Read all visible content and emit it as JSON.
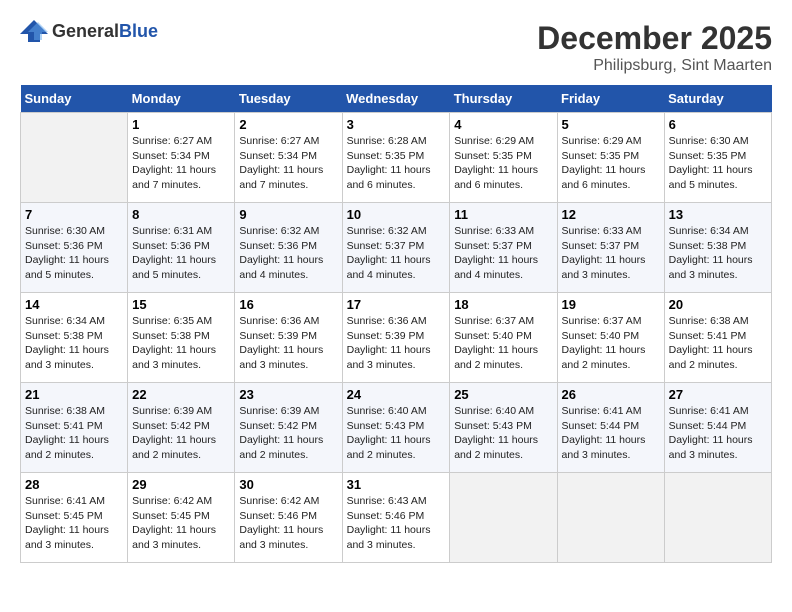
{
  "header": {
    "logo_general": "General",
    "logo_blue": "Blue",
    "month_title": "December 2025",
    "location": "Philipsburg, Sint Maarten"
  },
  "days_of_week": [
    "Sunday",
    "Monday",
    "Tuesday",
    "Wednesday",
    "Thursday",
    "Friday",
    "Saturday"
  ],
  "weeks": [
    [
      {
        "day": "",
        "sunrise": "",
        "sunset": "",
        "daylight": ""
      },
      {
        "day": "1",
        "sunrise": "Sunrise: 6:27 AM",
        "sunset": "Sunset: 5:34 PM",
        "daylight": "Daylight: 11 hours and 7 minutes."
      },
      {
        "day": "2",
        "sunrise": "Sunrise: 6:27 AM",
        "sunset": "Sunset: 5:34 PM",
        "daylight": "Daylight: 11 hours and 7 minutes."
      },
      {
        "day": "3",
        "sunrise": "Sunrise: 6:28 AM",
        "sunset": "Sunset: 5:35 PM",
        "daylight": "Daylight: 11 hours and 6 minutes."
      },
      {
        "day": "4",
        "sunrise": "Sunrise: 6:29 AM",
        "sunset": "Sunset: 5:35 PM",
        "daylight": "Daylight: 11 hours and 6 minutes."
      },
      {
        "day": "5",
        "sunrise": "Sunrise: 6:29 AM",
        "sunset": "Sunset: 5:35 PM",
        "daylight": "Daylight: 11 hours and 6 minutes."
      },
      {
        "day": "6",
        "sunrise": "Sunrise: 6:30 AM",
        "sunset": "Sunset: 5:35 PM",
        "daylight": "Daylight: 11 hours and 5 minutes."
      }
    ],
    [
      {
        "day": "7",
        "sunrise": "Sunrise: 6:30 AM",
        "sunset": "Sunset: 5:36 PM",
        "daylight": "Daylight: 11 hours and 5 minutes."
      },
      {
        "day": "8",
        "sunrise": "Sunrise: 6:31 AM",
        "sunset": "Sunset: 5:36 PM",
        "daylight": "Daylight: 11 hours and 5 minutes."
      },
      {
        "day": "9",
        "sunrise": "Sunrise: 6:32 AM",
        "sunset": "Sunset: 5:36 PM",
        "daylight": "Daylight: 11 hours and 4 minutes."
      },
      {
        "day": "10",
        "sunrise": "Sunrise: 6:32 AM",
        "sunset": "Sunset: 5:37 PM",
        "daylight": "Daylight: 11 hours and 4 minutes."
      },
      {
        "day": "11",
        "sunrise": "Sunrise: 6:33 AM",
        "sunset": "Sunset: 5:37 PM",
        "daylight": "Daylight: 11 hours and 4 minutes."
      },
      {
        "day": "12",
        "sunrise": "Sunrise: 6:33 AM",
        "sunset": "Sunset: 5:37 PM",
        "daylight": "Daylight: 11 hours and 3 minutes."
      },
      {
        "day": "13",
        "sunrise": "Sunrise: 6:34 AM",
        "sunset": "Sunset: 5:38 PM",
        "daylight": "Daylight: 11 hours and 3 minutes."
      }
    ],
    [
      {
        "day": "14",
        "sunrise": "Sunrise: 6:34 AM",
        "sunset": "Sunset: 5:38 PM",
        "daylight": "Daylight: 11 hours and 3 minutes."
      },
      {
        "day": "15",
        "sunrise": "Sunrise: 6:35 AM",
        "sunset": "Sunset: 5:38 PM",
        "daylight": "Daylight: 11 hours and 3 minutes."
      },
      {
        "day": "16",
        "sunrise": "Sunrise: 6:36 AM",
        "sunset": "Sunset: 5:39 PM",
        "daylight": "Daylight: 11 hours and 3 minutes."
      },
      {
        "day": "17",
        "sunrise": "Sunrise: 6:36 AM",
        "sunset": "Sunset: 5:39 PM",
        "daylight": "Daylight: 11 hours and 3 minutes."
      },
      {
        "day": "18",
        "sunrise": "Sunrise: 6:37 AM",
        "sunset": "Sunset: 5:40 PM",
        "daylight": "Daylight: 11 hours and 2 minutes."
      },
      {
        "day": "19",
        "sunrise": "Sunrise: 6:37 AM",
        "sunset": "Sunset: 5:40 PM",
        "daylight": "Daylight: 11 hours and 2 minutes."
      },
      {
        "day": "20",
        "sunrise": "Sunrise: 6:38 AM",
        "sunset": "Sunset: 5:41 PM",
        "daylight": "Daylight: 11 hours and 2 minutes."
      }
    ],
    [
      {
        "day": "21",
        "sunrise": "Sunrise: 6:38 AM",
        "sunset": "Sunset: 5:41 PM",
        "daylight": "Daylight: 11 hours and 2 minutes."
      },
      {
        "day": "22",
        "sunrise": "Sunrise: 6:39 AM",
        "sunset": "Sunset: 5:42 PM",
        "daylight": "Daylight: 11 hours and 2 minutes."
      },
      {
        "day": "23",
        "sunrise": "Sunrise: 6:39 AM",
        "sunset": "Sunset: 5:42 PM",
        "daylight": "Daylight: 11 hours and 2 minutes."
      },
      {
        "day": "24",
        "sunrise": "Sunrise: 6:40 AM",
        "sunset": "Sunset: 5:43 PM",
        "daylight": "Daylight: 11 hours and 2 minutes."
      },
      {
        "day": "25",
        "sunrise": "Sunrise: 6:40 AM",
        "sunset": "Sunset: 5:43 PM",
        "daylight": "Daylight: 11 hours and 2 minutes."
      },
      {
        "day": "26",
        "sunrise": "Sunrise: 6:41 AM",
        "sunset": "Sunset: 5:44 PM",
        "daylight": "Daylight: 11 hours and 3 minutes."
      },
      {
        "day": "27",
        "sunrise": "Sunrise: 6:41 AM",
        "sunset": "Sunset: 5:44 PM",
        "daylight": "Daylight: 11 hours and 3 minutes."
      }
    ],
    [
      {
        "day": "28",
        "sunrise": "Sunrise: 6:41 AM",
        "sunset": "Sunset: 5:45 PM",
        "daylight": "Daylight: 11 hours and 3 minutes."
      },
      {
        "day": "29",
        "sunrise": "Sunrise: 6:42 AM",
        "sunset": "Sunset: 5:45 PM",
        "daylight": "Daylight: 11 hours and 3 minutes."
      },
      {
        "day": "30",
        "sunrise": "Sunrise: 6:42 AM",
        "sunset": "Sunset: 5:46 PM",
        "daylight": "Daylight: 11 hours and 3 minutes."
      },
      {
        "day": "31",
        "sunrise": "Sunrise: 6:43 AM",
        "sunset": "Sunset: 5:46 PM",
        "daylight": "Daylight: 11 hours and 3 minutes."
      },
      {
        "day": "",
        "sunrise": "",
        "sunset": "",
        "daylight": ""
      },
      {
        "day": "",
        "sunrise": "",
        "sunset": "",
        "daylight": ""
      },
      {
        "day": "",
        "sunrise": "",
        "sunset": "",
        "daylight": ""
      }
    ]
  ]
}
